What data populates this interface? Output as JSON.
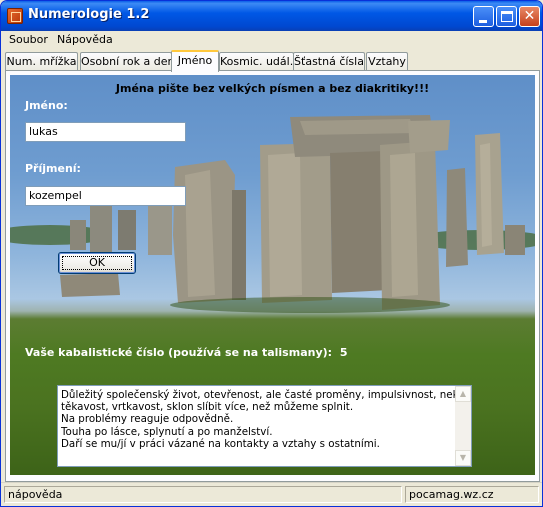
{
  "window": {
    "title": "Numerologie 1.2",
    "icon": "app-icon",
    "controls": [
      "minimize-icon",
      "maximize-icon",
      "close-icon"
    ]
  },
  "menu": {
    "items": [
      "Soubor",
      "Nápověda"
    ]
  },
  "tabs": {
    "items": [
      "Num. mřížka",
      "Osobní rok a den",
      "Jméno",
      "Kosmic. udál.",
      "Šťastná čísla",
      "Vztahy"
    ],
    "active": "Jméno"
  },
  "form": {
    "headline": "Jména pište bez velkých písmen a bez diakritiky!!!",
    "first_name_label": "Jméno:",
    "first_name_value": "lukas",
    "last_name_label": "Příjmení:",
    "last_name_value": "kozempel",
    "ok_label": "OK"
  },
  "result": {
    "label": "Vaše kabalistické číslo (používá se na talismany):",
    "value": "5",
    "text_lines": [
      "Důležitý společenský život, otevřenost, ale časté proměny, impulsivnost, neklid,",
      "těkavost, vrtkavost, sklon slíbit více, než můžeme splnit.",
      "Na problémy reaguje odpovědně.",
      "Touha po lásce, splynutí a po manželství.",
      "Daří se mu/jí v práci vázané na kontakty a vztahy s ostatními."
    ]
  },
  "statusbar": {
    "left": "nápověda",
    "right": "pocamag.wz.cz"
  },
  "colors": {
    "titlebar": "#0058e6",
    "active_tab_accent": "#ffc83c",
    "label_text": "#ffffff"
  }
}
